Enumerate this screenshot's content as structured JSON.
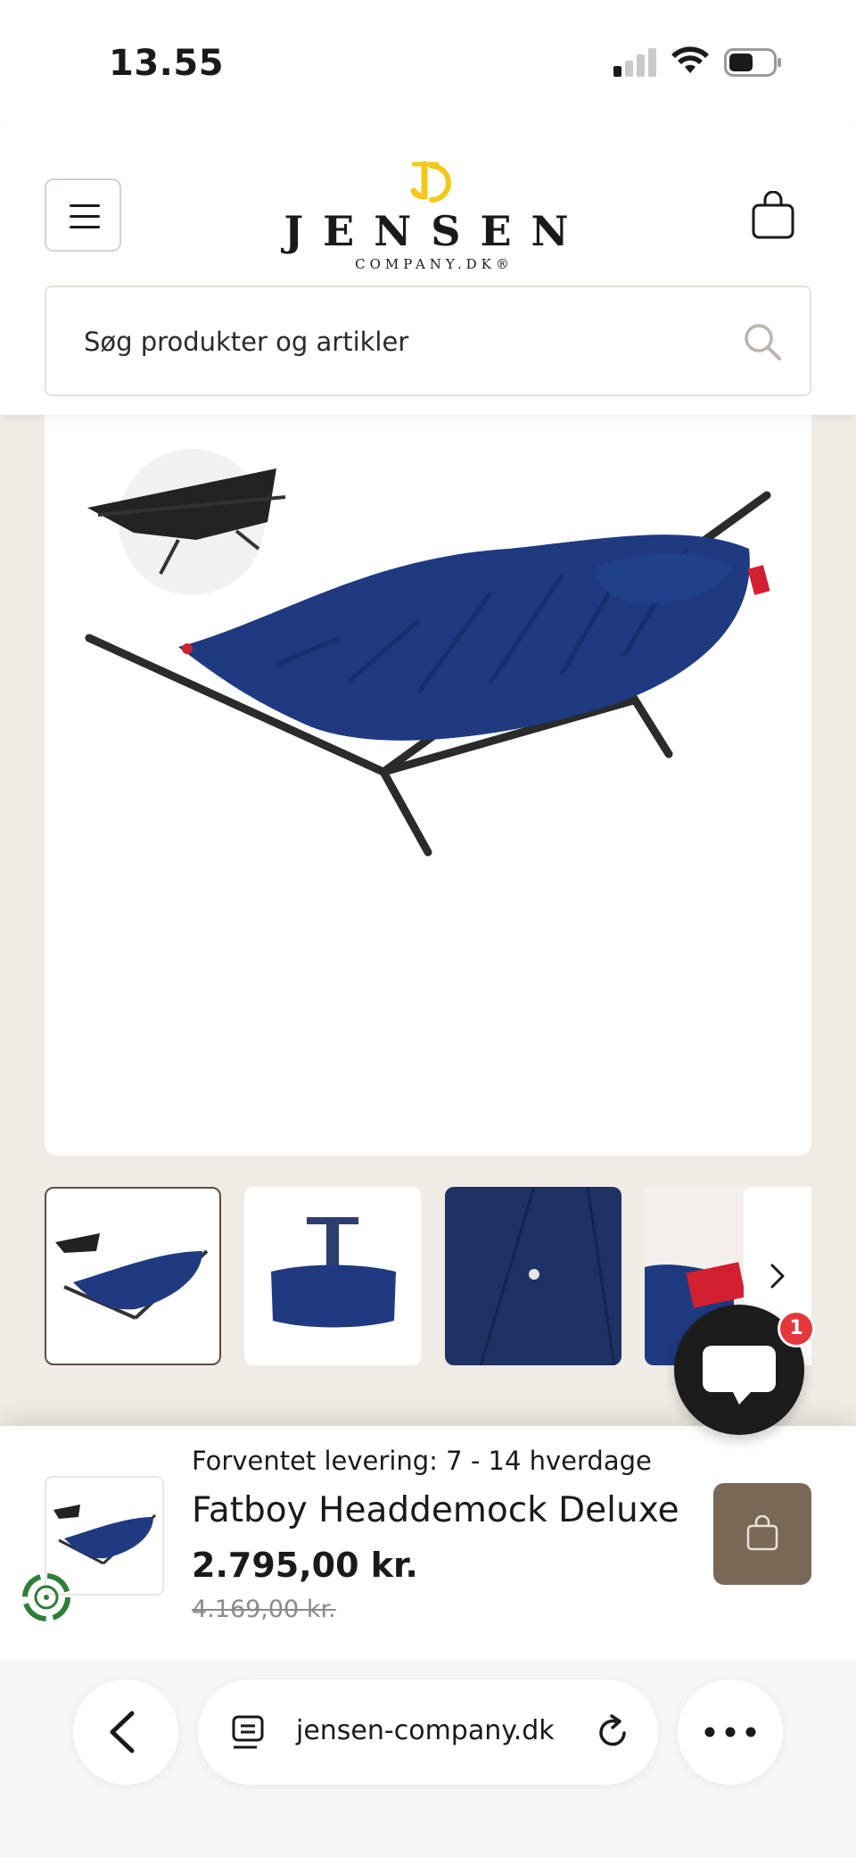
{
  "status_bar": {
    "time": "13.55"
  },
  "header": {
    "logo_name": "JENSEN",
    "logo_sub": "COMPANY.DK®",
    "search_placeholder": "Søg produkter og artikler"
  },
  "gallery": {
    "thumbnail_count": 4,
    "active_index": 0
  },
  "chat": {
    "badge_count": "1"
  },
  "sticky_bar": {
    "delivery": "Forventet levering: 7 - 14 hverdage",
    "title": "Fatboy Headdemock Deluxe",
    "price": "2.795,00 kr.",
    "old_price": "4.169,00 kr."
  },
  "browser": {
    "url": "jensen-company.dk"
  },
  "colors": {
    "accent_brown": "#7a6857",
    "hammock_blue": "#1f3a80",
    "page_bg": "#f0ece5",
    "logo_yellow": "#f2c919",
    "badge_red": "#e5383b"
  },
  "icons": [
    "menu-icon",
    "bag-icon",
    "search-icon",
    "chevron-right-icon",
    "chat-icon",
    "back-icon",
    "tabs-icon",
    "reload-icon",
    "more-icon",
    "recycle-icon"
  ]
}
